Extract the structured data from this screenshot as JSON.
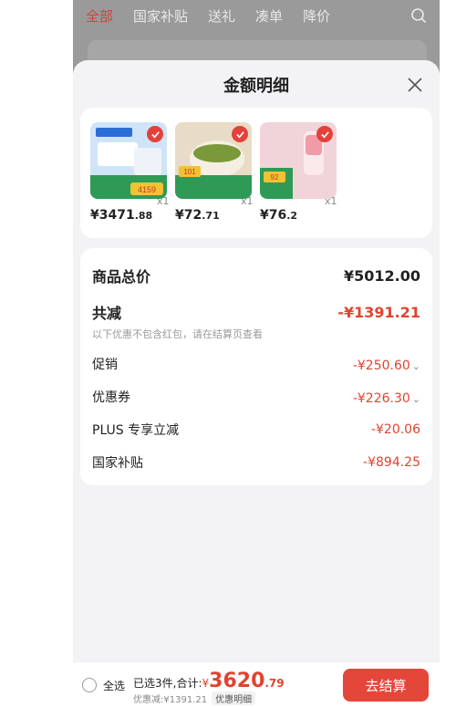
{
  "nav": {
    "tabs": [
      "全部",
      "国家补贴",
      "送礼",
      "凑单",
      "降价"
    ],
    "search_icon": "search-icon"
  },
  "sheet": {
    "title": "金额明细",
    "close_icon": "close-icon"
  },
  "products": [
    {
      "price_int": "¥3471",
      "price_dec": ".88",
      "qty": "x1",
      "thumb_label": "4159",
      "thumb_colors": [
        "#cfe4f7",
        "#ffffff",
        "#2e9a55"
      ]
    },
    {
      "price_int": "¥72",
      "price_dec": ".71",
      "qty": "x1",
      "thumb_label": "101",
      "thumb_colors": [
        "#e9dcc6",
        "#f5efe3",
        "#2e9a55"
      ]
    },
    {
      "price_int": "¥76",
      "price_dec": ".2",
      "qty": "x1",
      "thumb_label": "92",
      "thumb_colors": [
        "#f1d4d9",
        "#fbe9ec",
        "#2e9a55"
      ]
    }
  ],
  "summary": {
    "total_label": "商品总价",
    "total_value": "¥5012.00",
    "reduce_label": "共减",
    "reduce_value": "-¥1391.21",
    "note": "以下优惠不包含红包，请在结算页查看",
    "items": [
      {
        "label": "促销",
        "value": "-¥250.60",
        "chevron": "⌄"
      },
      {
        "label": "优惠券",
        "value": "-¥226.30",
        "chevron": "⌄"
      },
      {
        "label": "PLUS 专享立减",
        "value": "-¥20.06",
        "chevron": ""
      },
      {
        "label": "国家补贴",
        "value": "-¥894.25",
        "chevron": ""
      }
    ]
  },
  "footer": {
    "select_all": "全选",
    "selected_prefix": "已选3件,合计:",
    "yen": "¥",
    "total_big": "3620",
    "total_small": ".79",
    "discount_line": "优惠减:¥1391.21",
    "detail_btn": "优惠明细",
    "checkout": "去结算"
  },
  "colors": {
    "accent": "#e5463a",
    "overlay": "#9a9a9a"
  }
}
